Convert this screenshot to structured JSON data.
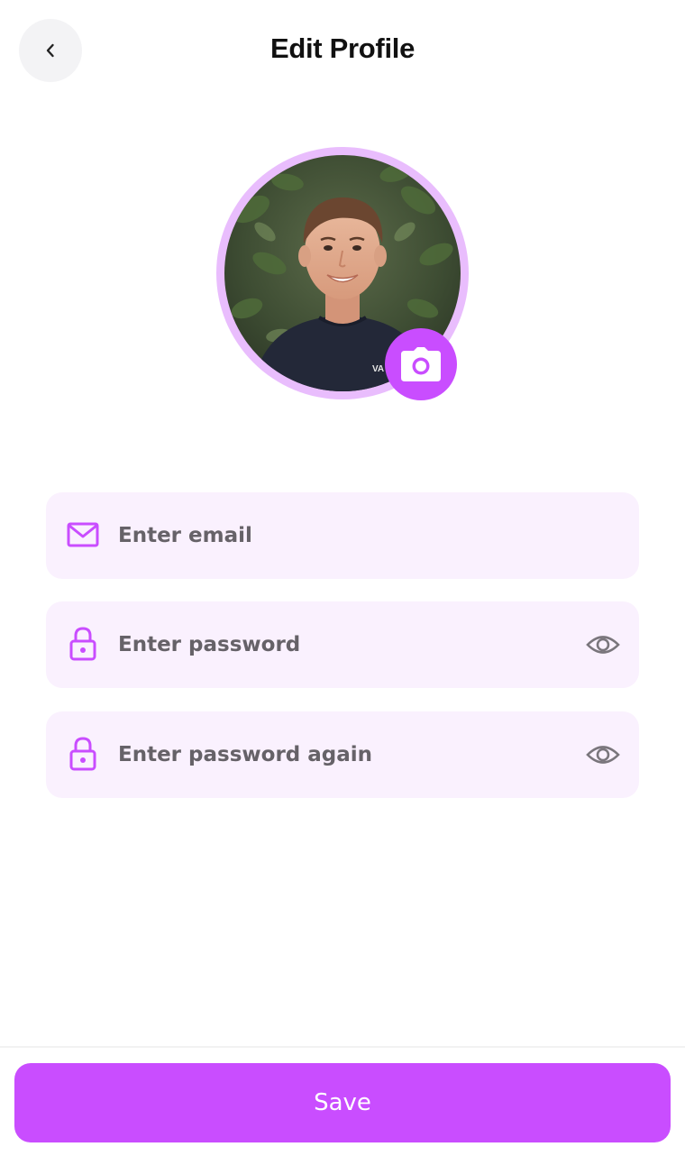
{
  "header": {
    "title": "Edit Profile",
    "back_icon": "chevron-left-icon"
  },
  "avatar": {
    "description_icon": "avatar",
    "camera_icon": "camera-icon",
    "ring_color": "#e9bdfd",
    "accent_color": "#c94dff"
  },
  "form": {
    "email": {
      "icon": "mail-icon",
      "value": "",
      "placeholder": "Enter email"
    },
    "password": {
      "icon": "lock-icon",
      "value": "",
      "placeholder": "Enter password",
      "toggle_icon": "eye-icon"
    },
    "password_again": {
      "icon": "lock-icon",
      "value": "",
      "placeholder": "Enter password again",
      "toggle_icon": "eye-icon"
    },
    "field_background": "#faf1fe"
  },
  "actions": {
    "save_label": "Save",
    "save_color": "#c94dff"
  }
}
